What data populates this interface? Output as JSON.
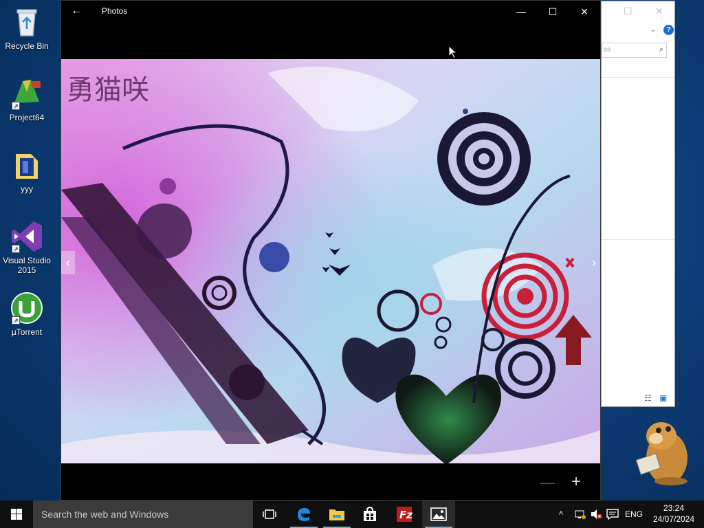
{
  "desktop": {
    "icons": [
      {
        "label": "Recycle Bin"
      },
      {
        "label": "Project64"
      },
      {
        "label": "yyy"
      },
      {
        "label": "Visual Studio 2015"
      },
      {
        "label": "µTorrent"
      }
    ]
  },
  "photos_window": {
    "title": "Photos",
    "image_caption": "勇猫咲"
  },
  "background_window": {
    "search_partial": "ss",
    "help": "?"
  },
  "taskbar": {
    "search_placeholder": "Search the web and Windows",
    "language": "ENG",
    "time": "23:24",
    "date": "24/07/2024"
  }
}
